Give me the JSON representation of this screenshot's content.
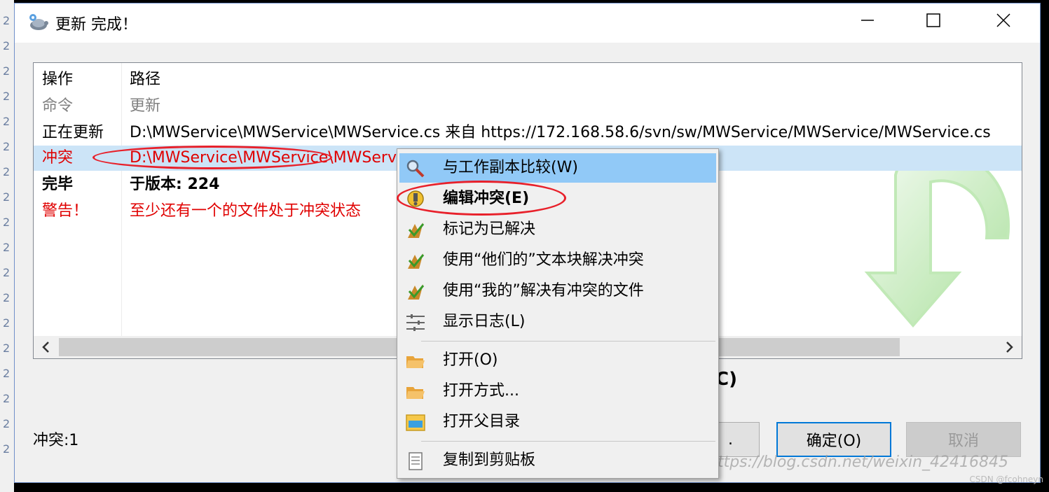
{
  "window": {
    "title": "更新 完成！"
  },
  "edge_text": [
    "2",
    "2",
    "2",
    "2",
    "2",
    "2",
    "2",
    "2",
    "2",
    "2",
    "2",
    "2",
    "2",
    "2",
    "2",
    "2",
    "2",
    "2"
  ],
  "list": {
    "rows": [
      {
        "action": "操作",
        "path": "路径",
        "style": "header"
      },
      {
        "action": "命令",
        "path": "更新",
        "style": "gray"
      },
      {
        "action": "正在更新",
        "path": "D:\\MWService\\MWService\\MWService.cs 来自 https://172.168.58.6/svn/sw/MWService/MWService/MWService.cs",
        "style": "black"
      },
      {
        "action": "冲突",
        "path": "D:\\MWService\\MWService\\MWServ",
        "style": "red selected"
      },
      {
        "action": "完毕",
        "path": "于版本: 224",
        "style": "black bold"
      },
      {
        "action": "警告！",
        "path": "至少还有一个的文件处于冲突状态",
        "style": "red"
      }
    ]
  },
  "status": {
    "conflicts": "冲突:1"
  },
  "partial_label": "C)",
  "buttons": {
    "hidden_partial": ".",
    "ok": "确定(O)",
    "cancel": "取消"
  },
  "watermark": "https://blog.csdn.net/weixin_42416845",
  "credit": "CSDN @fcohneyn",
  "context_menu": {
    "items": [
      {
        "label": "与工作副本比较(W)",
        "icon": "magnifier-icon",
        "state": "hover"
      },
      {
        "label": "编辑冲突(E)",
        "icon": "edit-conflict-icon",
        "state": "bold"
      },
      {
        "label": "标记为已解决",
        "icon": "resolve-icon",
        "state": ""
      },
      {
        "label": "使用“他们的”文本块解决冲突",
        "icon": "resolve-icon",
        "state": ""
      },
      {
        "label": "使用“我的”解决有冲突的文件",
        "icon": "resolve-icon",
        "state": ""
      },
      {
        "label": "显示日志(L)",
        "icon": "log-icon",
        "state": ""
      },
      {
        "label": "打开(O)",
        "icon": "folder-open-icon",
        "state": ""
      },
      {
        "label": "打开方式...",
        "icon": "folder-open-icon",
        "state": ""
      },
      {
        "label": "打开父目录",
        "icon": "explorer-icon",
        "state": ""
      },
      {
        "label": "复制到剪贴板",
        "icon": "clipboard-icon",
        "state": ""
      }
    ]
  },
  "colors": {
    "accent": "#0078d7",
    "conflict_red": "#e00000",
    "annotation_red": "#e8202a",
    "hover_blue": "#91c9f7",
    "selected_row": "#cce4f7"
  }
}
